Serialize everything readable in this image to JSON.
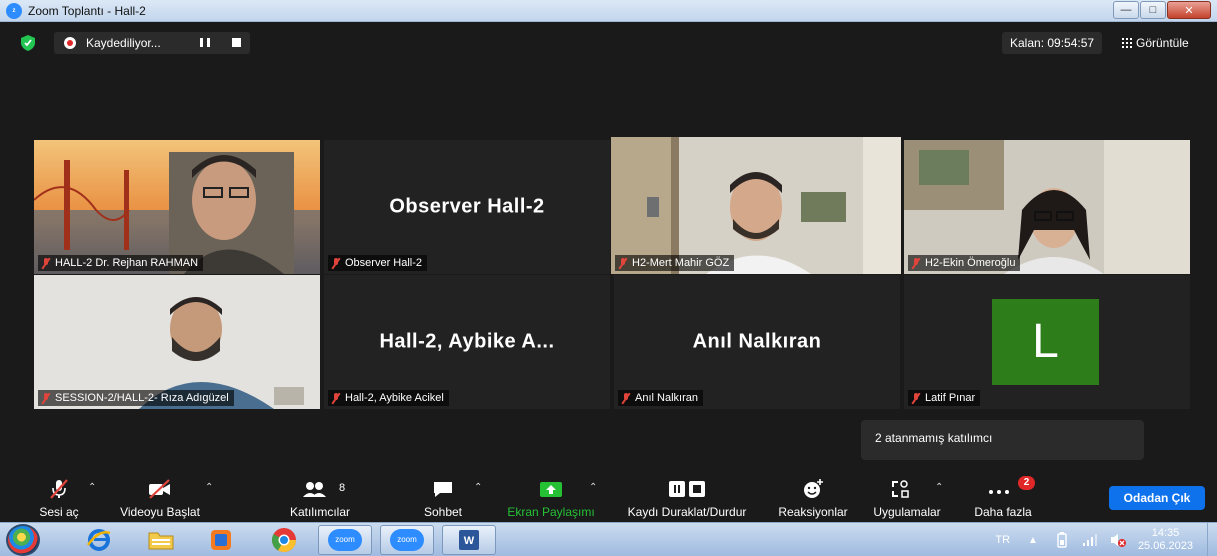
{
  "window": {
    "title": "Zoom Toplantı - Hall-2"
  },
  "topbar": {
    "recording_label": "Kaydediliyor...",
    "timer": "Kalan: 09:54:57",
    "view_label": "Görüntüle"
  },
  "tiles": [
    {
      "name": "HALL-2  Dr. Rejhan RAHMAN",
      "type": "video",
      "active": false
    },
    {
      "name": "Observer Hall-2",
      "display_name": "Observer Hall-2",
      "type": "name-only",
      "active": false
    },
    {
      "name": "H2-Mert Mahir GÖZ",
      "type": "video",
      "active": true
    },
    {
      "name": "H2-Ekin Ömeroğlu",
      "type": "video",
      "active": false
    },
    {
      "name": "SESSION-2/HALL-2- Rıza Adıgüzel",
      "type": "video",
      "active": false
    },
    {
      "name": "Hall-2, Aybike Acikel",
      "display_name": "Hall-2, Aybike A...",
      "type": "name-only",
      "active": false
    },
    {
      "name": "Anıl Nalkıran",
      "display_name": "Anıl Nalkıran",
      "type": "name-only",
      "active": false
    },
    {
      "name": "Latif Pınar",
      "avatar_letter": "L",
      "avatar_color": "#2e7d1b",
      "type": "avatar",
      "active": false
    }
  ],
  "tooltip": {
    "text": "2 atanmamış katılımcı"
  },
  "toolbar": {
    "audio_label": "Sesi aç",
    "video_label": "Videoyu Başlat",
    "participants_label": "Katılımcılar",
    "participants_count": "8",
    "chat_label": "Sohbet",
    "share_label": "Ekran Paylaşımı",
    "recording_label": "Kaydı Duraklat/Durdur",
    "reactions_label": "Reaksiyonlar",
    "apps_label": "Uygulamalar",
    "more_label": "Daha fazla",
    "more_badge": "2",
    "leave_label": "Odadan Çık"
  },
  "taskbar": {
    "zoom_label": "zoom",
    "zoom_label_2": "zoom",
    "language": "TR",
    "time": "14:35",
    "date": "25.06.2023"
  },
  "colors": {
    "active_speaker": "#d9f26a",
    "share_green": "#26c035",
    "leave_blue": "#0e72ed",
    "muted_red": "#e0443b"
  }
}
